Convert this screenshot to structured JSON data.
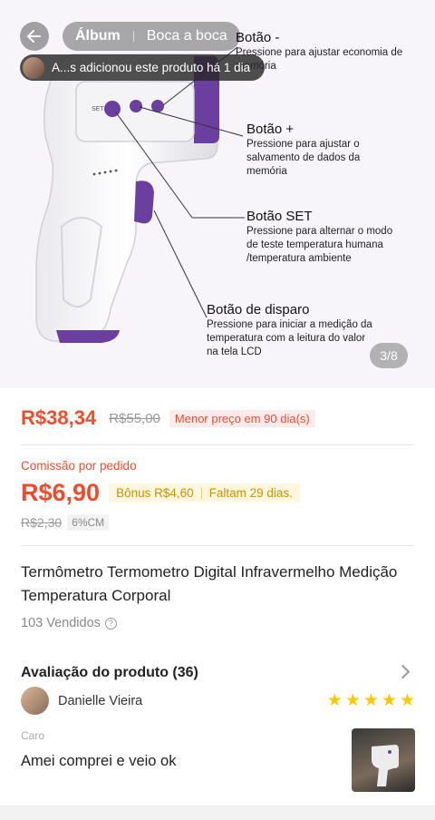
{
  "hero": {
    "annotations": [
      {
        "title": "Botão -",
        "desc": "Pressione para ajustar economia de\nmemória"
      },
      {
        "title": "Botão +",
        "desc": "Pressione para  ajustar o\nsalvamento de dados da\nmemória"
      },
      {
        "title": "Botão SET",
        "desc": "Pressione para alternar o modo\nde teste temperatura humana\n/temperatura ambiente"
      },
      {
        "title": "Botão de disparo",
        "desc": "Pressione para iniciar a medição da\ntemperatura com a leitura do valor\nna tela LCD"
      }
    ],
    "set_label": "SET",
    "counter": "3/8"
  },
  "topbar": {
    "tabs": [
      "Álbum",
      "Boca a boca"
    ],
    "notification": "A...s adicionou este produto há 1 dia"
  },
  "price": {
    "current": "R$38,34",
    "original": "R$55,00",
    "badge": "Menor preço em 90 dia(s)"
  },
  "commission": {
    "label": "Comissão por pedido",
    "value": "R$6,90",
    "bonus": "Bônus R$4,60",
    "remaining": "Faltam 29 dias.",
    "old": "R$2,30",
    "rate": "6%CM"
  },
  "product": {
    "title": "Termômetro Termometro Digital Infravermelho Medição Temperatura Corporal",
    "sold": "103 Vendidos"
  },
  "reviews": {
    "header": "Avaliação do produto (36)",
    "reviewer": "Danielle Vieira",
    "rating": 5,
    "variation": "Caro",
    "comment": "Amei comprei e veio ok"
  },
  "colors": {
    "accent": "#ee4d2d",
    "device_purple": "#6b3fa0",
    "star": "#f8c800"
  }
}
